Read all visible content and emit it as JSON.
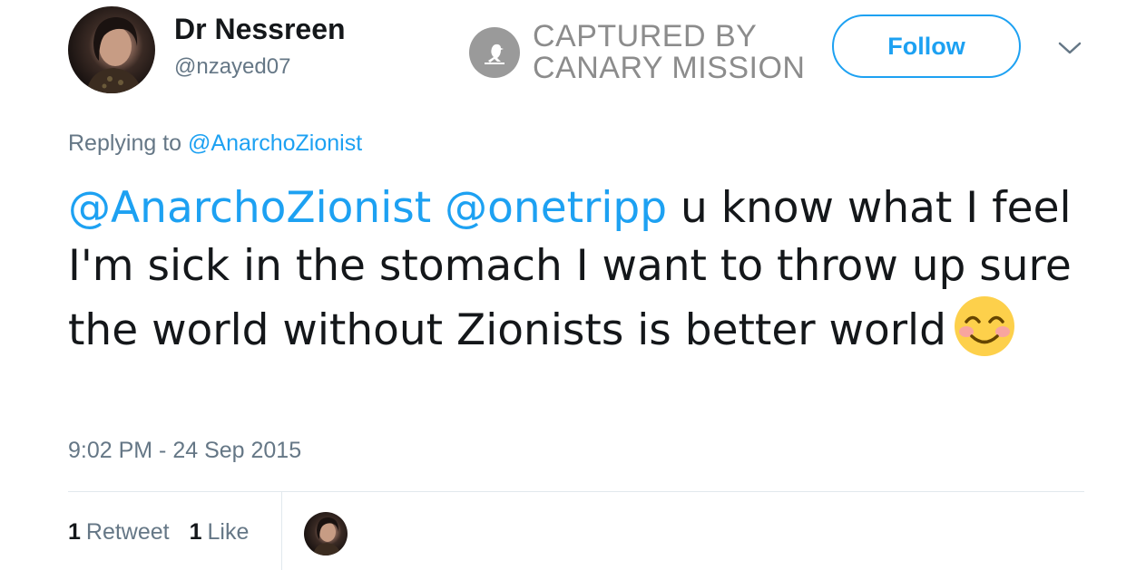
{
  "author": {
    "display_name": "Dr Nessreen",
    "handle": "@nzayed07"
  },
  "watermark": {
    "line1": "CAPTURED BY",
    "line2": "CANARY MISSION",
    "logo_icon": "canary-bird-icon"
  },
  "follow": {
    "label": "Follow"
  },
  "menu": {
    "icon": "chevron-down-icon"
  },
  "reply_context": {
    "prefix": "Replying to",
    "mention": "@AnarchoZionist"
  },
  "tweet": {
    "mention1": "@AnarchoZionist",
    "mention2": "@onetripp",
    "body": " u know what I feel I'm sick in the stomach I want to throw up sure the world without Zionists is better world",
    "emoji_icon": "smiling-face-with-smiling-eyes-emoji"
  },
  "timestamp": "9:02 PM - 24 Sep 2015",
  "stats": {
    "retweets_count": "1",
    "retweets_label": "Retweet",
    "likes_count": "1",
    "likes_label": "Like"
  },
  "colors": {
    "accent": "#1da1f2",
    "secondary_text": "#657786",
    "primary_text": "#14171a",
    "watermark": "#8c8c8c"
  }
}
